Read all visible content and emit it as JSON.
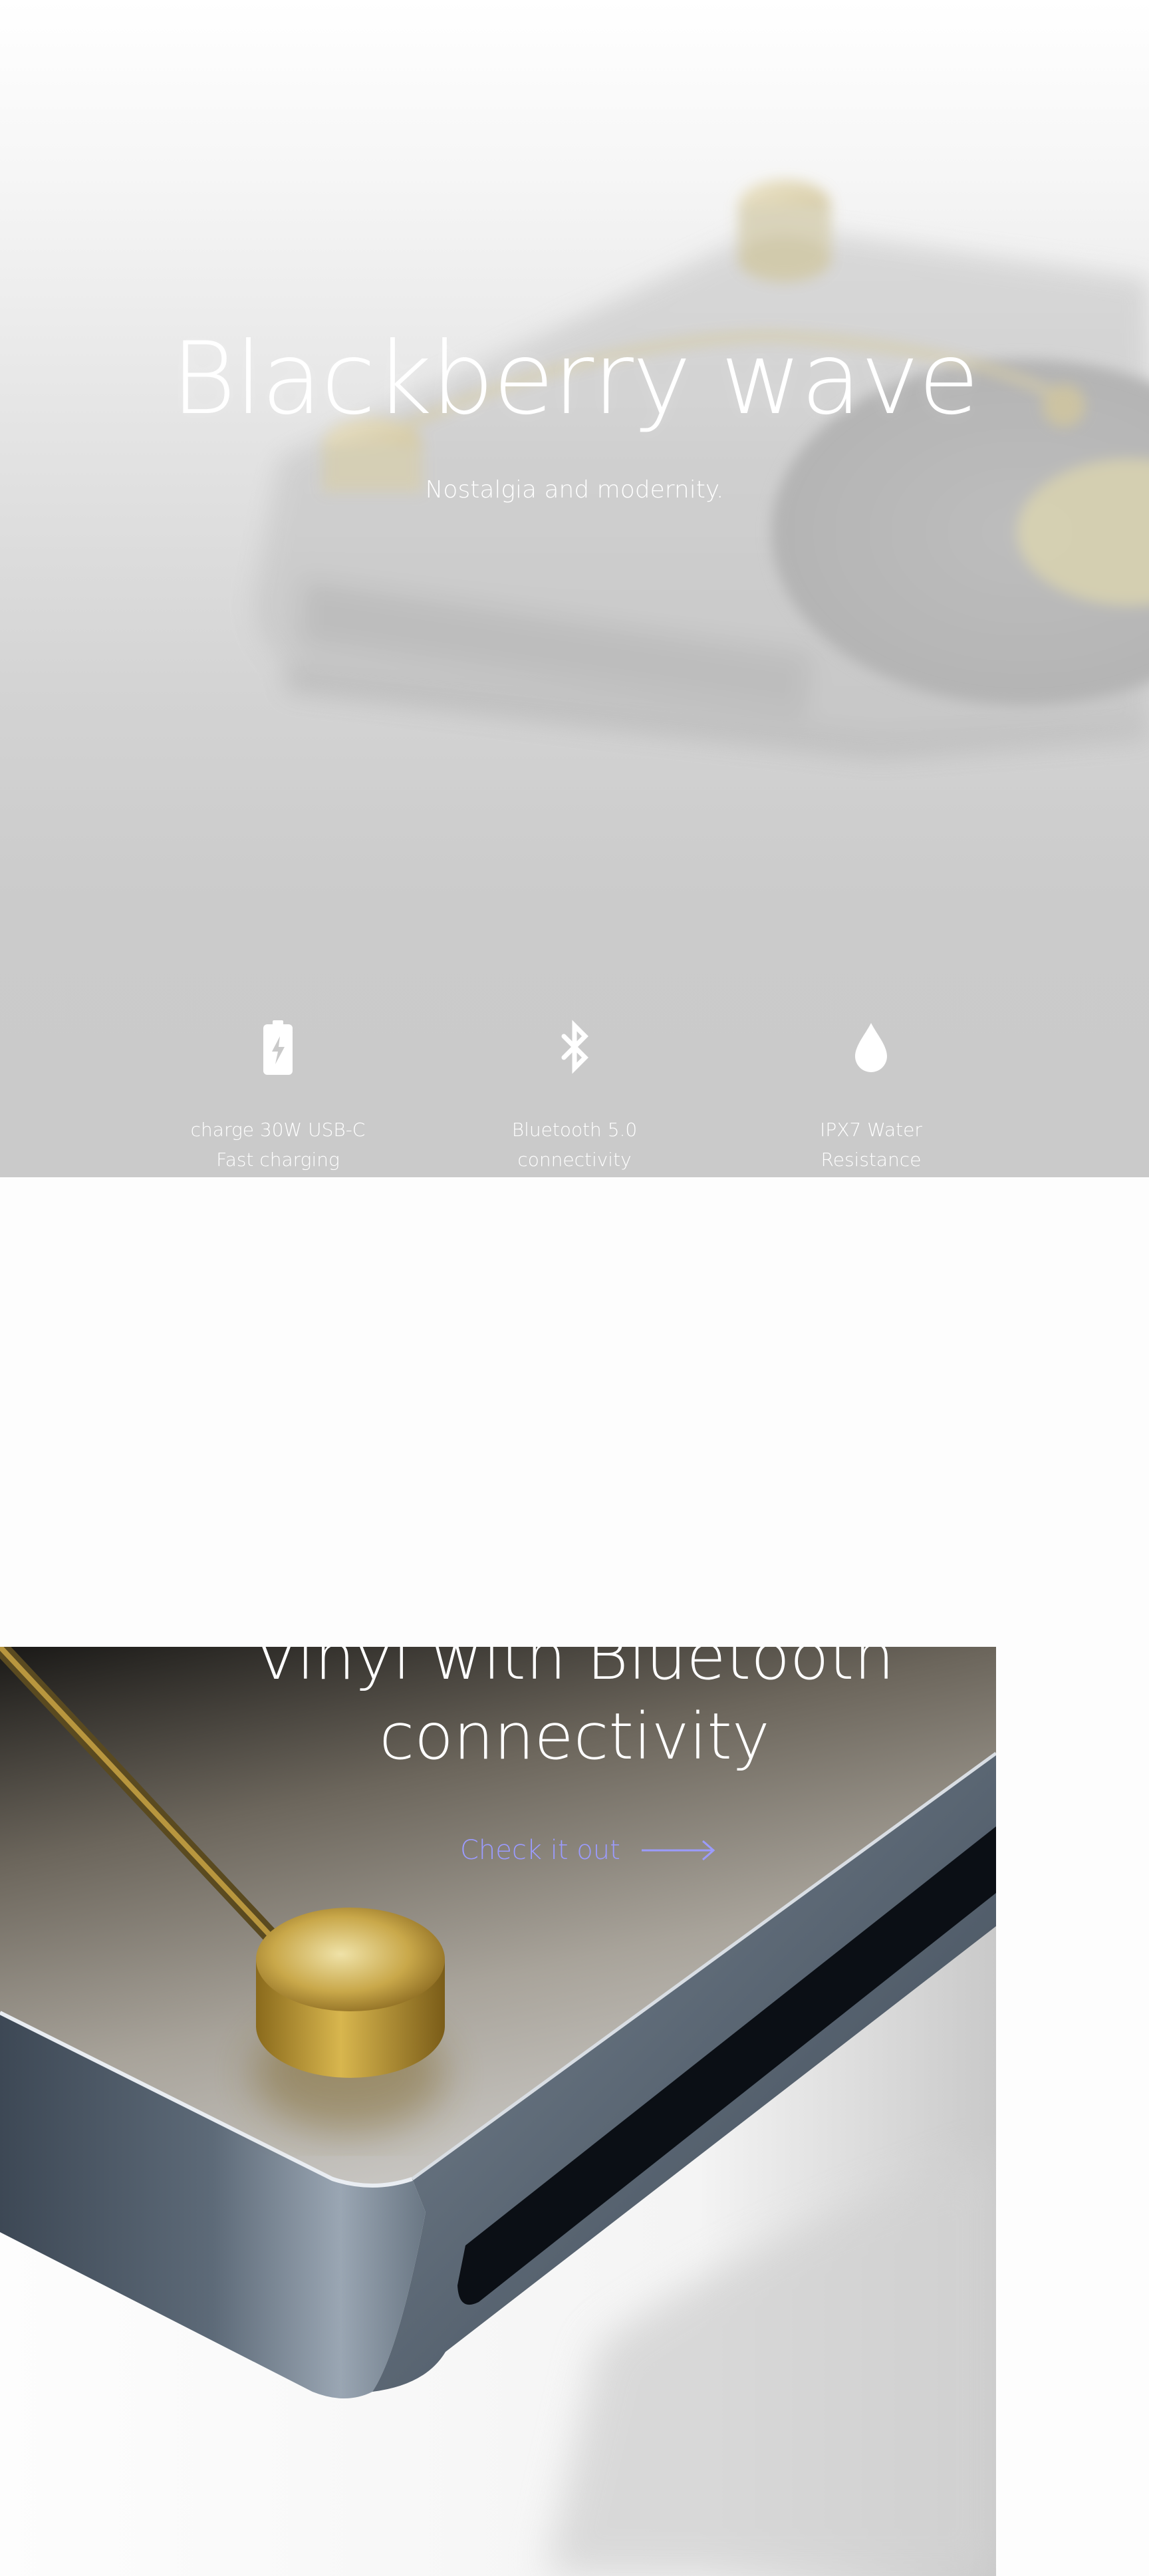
{
  "hero": {
    "title": "Blackberry wave",
    "subtitle": "Nostalgia and modernity.",
    "features": [
      {
        "icon": "battery-charging-icon",
        "line1": "charge 30W USB-C",
        "line2": "Fast charging"
      },
      {
        "icon": "bluetooth-icon",
        "line1": "Bluetooth 5.0",
        "line2": "connectivity"
      },
      {
        "icon": "water-drop-icon",
        "line1": "IPX7 Water",
        "line2": "Resistance"
      }
    ]
  },
  "promo": {
    "title_line1": "Vinyl with Bluetooth",
    "title_line2": "connectivity",
    "cta_label": "Check it out",
    "cta_icon": "arrow-right-icon"
  },
  "colors": {
    "hero_text": "#ffffff",
    "cta": "#9b9bff",
    "gold": "#c9a84a",
    "dark_body": "#1d2128"
  }
}
